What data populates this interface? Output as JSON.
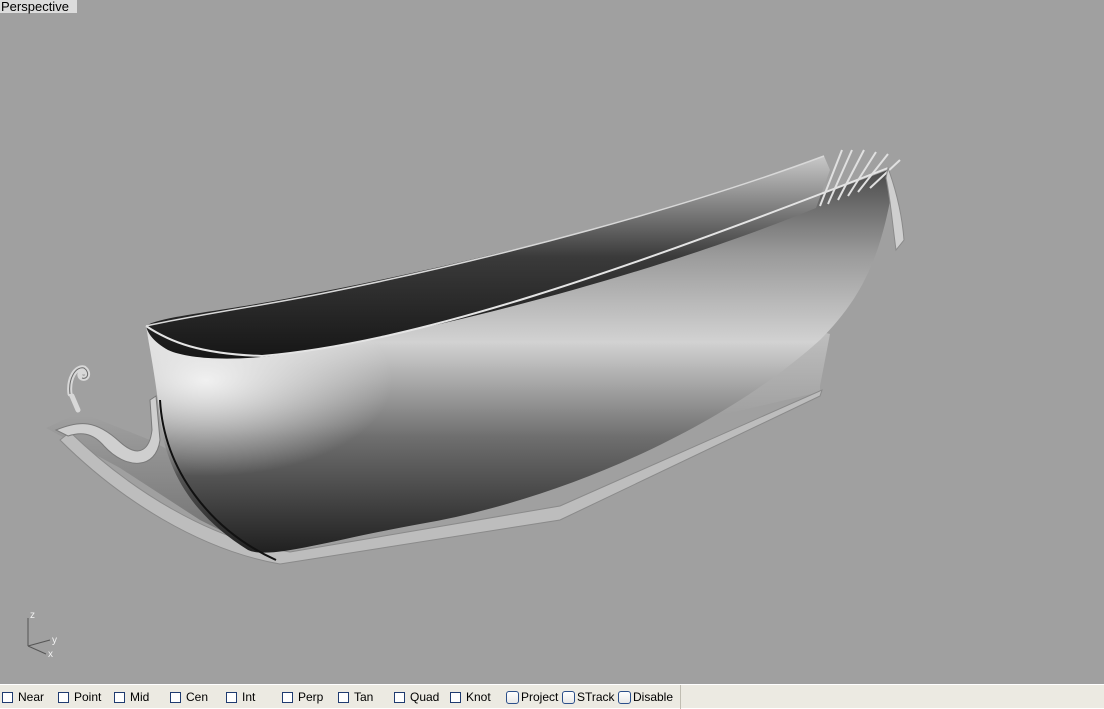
{
  "viewport": {
    "title": "Perspective"
  },
  "axes": {
    "z_label": "z",
    "y_label": "y",
    "x_label": "x"
  },
  "osnap": {
    "items": [
      {
        "label": "Near",
        "checked": false
      },
      {
        "label": "Point",
        "checked": false
      },
      {
        "label": "Mid",
        "checked": false
      },
      {
        "label": "Cen",
        "checked": false
      },
      {
        "label": "Int",
        "checked": false
      },
      {
        "label": "Perp",
        "checked": false
      },
      {
        "label": "Tan",
        "checked": false
      },
      {
        "label": "Quad",
        "checked": false
      },
      {
        "label": "Knot",
        "checked": false
      },
      {
        "label": "Project",
        "checked": false
      },
      {
        "label": "STrack",
        "checked": false
      },
      {
        "label": "Disable",
        "checked": false
      }
    ]
  },
  "colors": {
    "viewport_background": "#a0a0a0",
    "statusbar_background": "#eceae2"
  }
}
